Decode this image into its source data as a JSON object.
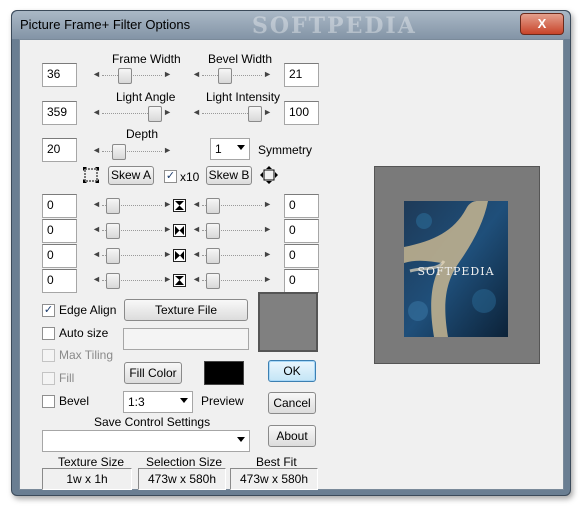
{
  "window": {
    "title": "Picture Frame+ Filter Options",
    "watermark": "SOFTPEDIA",
    "close_glyph": "X"
  },
  "frame_width": {
    "label": "Frame Width",
    "value": "36"
  },
  "bevel_width": {
    "label": "Bevel Width",
    "value": "21"
  },
  "light_angle": {
    "label": "Light Angle",
    "value": "359"
  },
  "light_intensity": {
    "label": "Light Intensity",
    "value": "100"
  },
  "depth": {
    "label": "Depth",
    "value": "20"
  },
  "symmetry": {
    "value": "1",
    "label": "Symmetry"
  },
  "skew": {
    "a_label": "Skew A",
    "b_label": "Skew B",
    "x10_label": "x10",
    "x10_checked": true
  },
  "skew_rows": [
    {
      "left": "0",
      "right": "0"
    },
    {
      "left": "0",
      "right": "0"
    },
    {
      "left": "0",
      "right": "0"
    },
    {
      "left": "0",
      "right": "0"
    }
  ],
  "options": {
    "edge_align": {
      "label": "Edge Align",
      "checked": true
    },
    "auto_size": {
      "label": "Auto size",
      "checked": false
    },
    "max_tiling": {
      "label": "Max Tiling",
      "checked": false,
      "disabled": true
    },
    "fill": {
      "label": "Fill",
      "checked": false,
      "disabled": true
    },
    "bevel": {
      "label": "Bevel",
      "checked": false
    }
  },
  "buttons": {
    "texture_file": "Texture File",
    "fill_color": "Fill Color",
    "ok": "OK",
    "cancel": "Cancel",
    "about": "About"
  },
  "colors": {
    "texture_swatch": "#808080",
    "fill_swatch": "#000000",
    "preview_frame": "#7a7a7a"
  },
  "ratio": {
    "value": "1:3",
    "label": "Preview"
  },
  "save_control": {
    "label": "Save Control Settings",
    "value": ""
  },
  "info": {
    "texture_size_label": "Texture Size",
    "texture_size": "1w x 1h",
    "selection_size_label": "Selection Size",
    "selection_size": "473w x 580h",
    "best_fit_label": "Best Fit",
    "best_fit": "473w x 580h"
  },
  "preview": {
    "watermark": "SOFTPEDIA"
  }
}
